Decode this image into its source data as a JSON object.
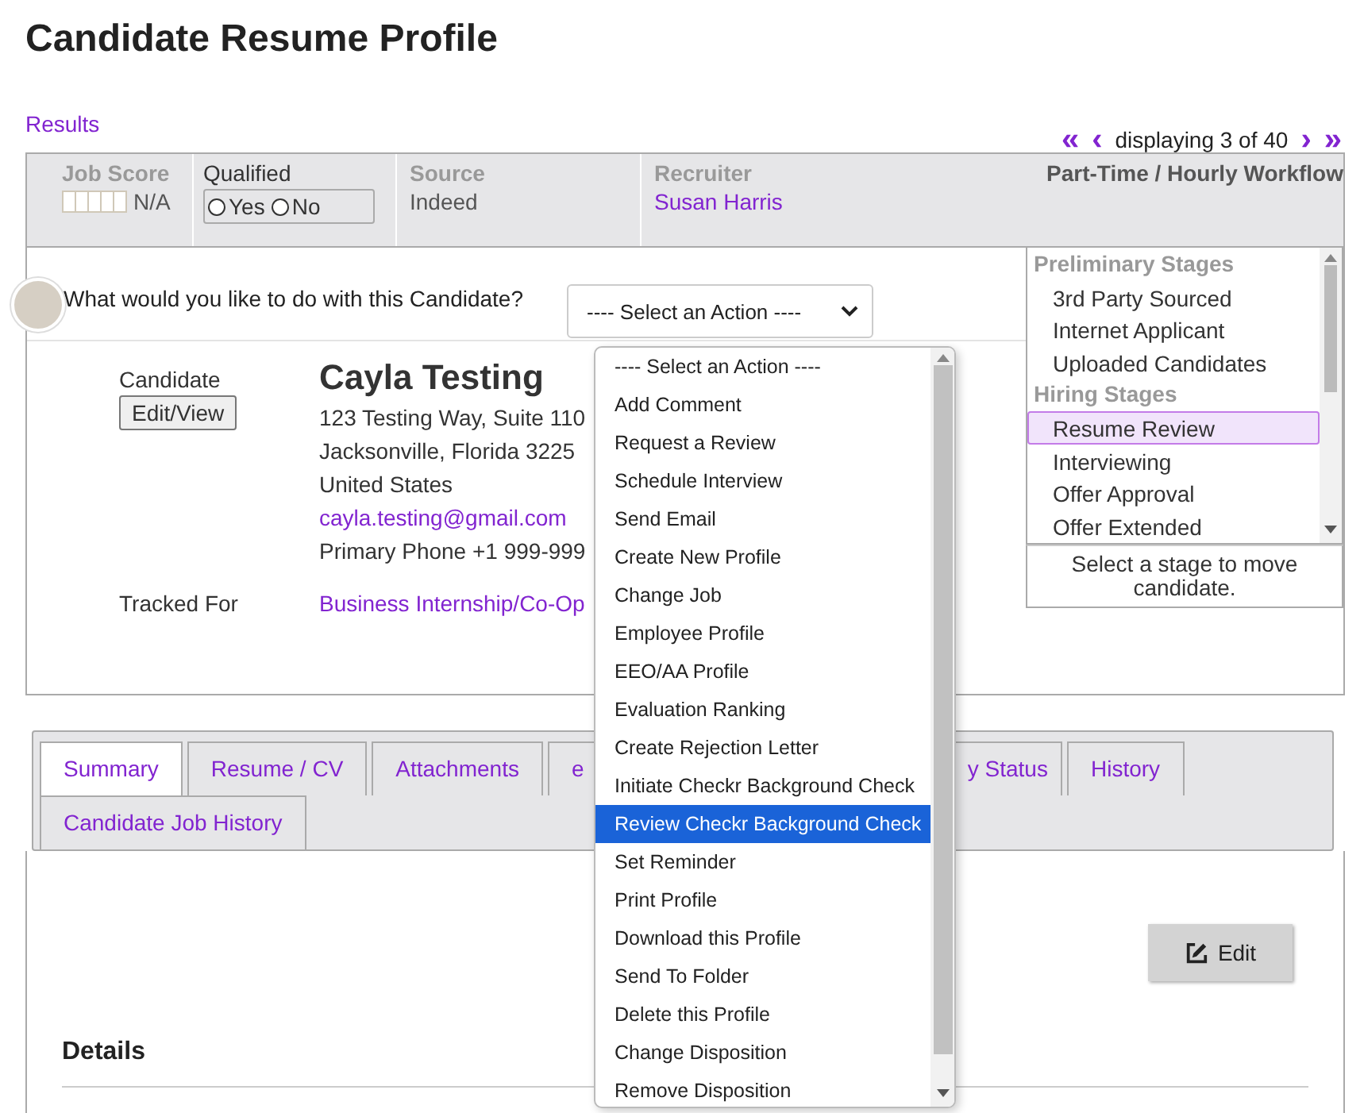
{
  "title": "Candidate Resume Profile",
  "results_link": "Results",
  "pager": {
    "first": "«",
    "prev": "‹",
    "text": "displaying 3 of 40",
    "next": "›",
    "last": "»"
  },
  "header": {
    "job_score": {
      "label": "Job Score",
      "value": "N/A"
    },
    "qualified": {
      "label": "Qualified",
      "options": [
        {
          "label": "Yes",
          "checked": false
        },
        {
          "label": "No",
          "checked": false
        }
      ]
    },
    "source": {
      "label": "Source",
      "value": "Indeed"
    },
    "recruiter": {
      "label": "Recruiter",
      "value": "Susan Harris"
    },
    "workflow": "Part-Time / Hourly Workflow"
  },
  "action": {
    "question": "What would you like to do with this Candidate?",
    "select_value": "---- Select an Action ----"
  },
  "candidate": {
    "label": "Candidate",
    "edit_button": "Edit/View",
    "name": "Cayla Testing",
    "address_lines": [
      "123 Testing Way, Suite 110",
      "Jacksonville, Florida  3225",
      "United States"
    ],
    "email": "cayla.testing@gmail.com",
    "phone": "Primary Phone +1 999-999",
    "tracked_label": "Tracked For",
    "tracked_value": "Business Internship/Co-Op"
  },
  "stages": {
    "items": [
      {
        "kind": "group",
        "label": "Preliminary Stages"
      },
      {
        "kind": "option",
        "label": "3rd Party Sourced",
        "selected": false
      },
      {
        "kind": "option",
        "label": "Internet Applicant",
        "selected": false
      },
      {
        "kind": "option",
        "label": "Uploaded Candidates",
        "selected": false
      },
      {
        "kind": "group",
        "label": "Hiring Stages"
      },
      {
        "kind": "option",
        "label": "Resume Review",
        "selected": true
      },
      {
        "kind": "option",
        "label": "Interviewing",
        "selected": false
      },
      {
        "kind": "option",
        "label": "Offer Approval",
        "selected": false
      },
      {
        "kind": "option",
        "label": "Offer Extended",
        "selected": false
      }
    ],
    "hint": "Select a stage to move candidate."
  },
  "tabs": [
    {
      "label": "Summary",
      "selected": true
    },
    {
      "label": "Resume / CV",
      "selected": false
    },
    {
      "label": "Attachments",
      "selected": false
    },
    {
      "label": "e",
      "selected": false
    },
    {
      "label": "y Status",
      "selected": false
    },
    {
      "label": "History",
      "selected": false
    },
    {
      "label": "Candidate Job History",
      "selected": false
    }
  ],
  "edit_button": "Edit",
  "details_heading": "Details",
  "action_menu": [
    {
      "label": "---- Select an Action ----",
      "selected": false
    },
    {
      "label": "Add Comment",
      "selected": false
    },
    {
      "label": "Request a Review",
      "selected": false
    },
    {
      "label": "Schedule Interview",
      "selected": false
    },
    {
      "label": "Send Email",
      "selected": false
    },
    {
      "label": "Create New Profile",
      "selected": false
    },
    {
      "label": "Change Job",
      "selected": false
    },
    {
      "label": "Employee Profile",
      "selected": false
    },
    {
      "label": "EEO/AA Profile",
      "selected": false
    },
    {
      "label": "Evaluation Ranking",
      "selected": false
    },
    {
      "label": "Create Rejection Letter",
      "selected": false
    },
    {
      "label": "Initiate Checkr Background Check",
      "selected": false
    },
    {
      "label": "Review Checkr Background Check",
      "selected": true
    },
    {
      "label": "Set Reminder",
      "selected": false
    },
    {
      "label": "Print Profile",
      "selected": false
    },
    {
      "label": "Download this Profile",
      "selected": false
    },
    {
      "label": "Send To Folder",
      "selected": false
    },
    {
      "label": "Delete this Profile",
      "selected": false
    },
    {
      "label": "Change Disposition",
      "selected": false
    },
    {
      "label": "Remove Disposition",
      "selected": false
    }
  ]
}
